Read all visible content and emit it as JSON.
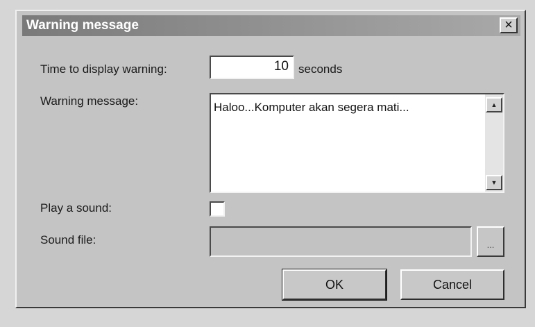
{
  "window": {
    "title": "Warning message",
    "close_glyph": "×"
  },
  "form": {
    "time_label": "Time to display warning:",
    "time_value": "10",
    "time_unit": "seconds",
    "message_label": "Warning message:",
    "message_value": "Haloo...Komputer akan segera mati...",
    "sound_label": "Play a sound:",
    "sound_checked": false,
    "sound_file_label": "Sound file:",
    "sound_file_value": "",
    "browse_label": "..."
  },
  "scrollbar": {
    "up_glyph": "▲",
    "down_glyph": "▼"
  },
  "buttons": {
    "ok_label": "OK",
    "cancel_label": "Cancel"
  },
  "icons": {
    "close": "close-icon",
    "scroll_up": "scroll-up-icon",
    "scroll_down": "scroll-down-icon"
  }
}
